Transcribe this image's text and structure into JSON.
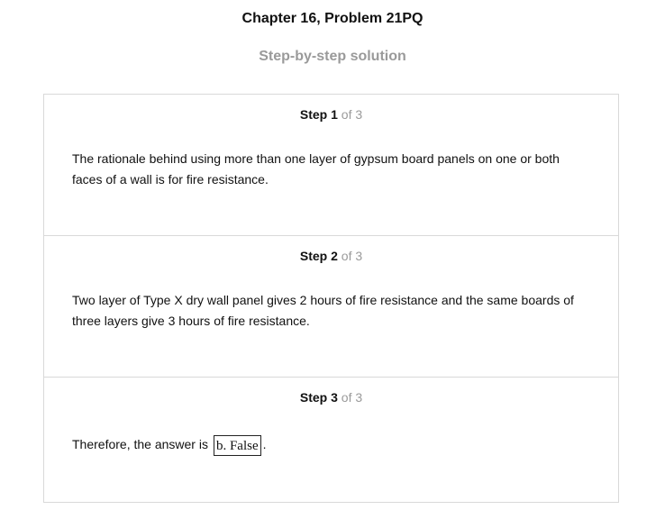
{
  "header": {
    "title": "Chapter 16, Problem 21PQ",
    "subtitle": "Step-by-step solution"
  },
  "steps": [
    {
      "label": "Step",
      "number": "1",
      "of_total": "of 3",
      "text": "The rationale behind using more than one layer of gypsum board panels on one or both faces of a wall is for fire resistance."
    },
    {
      "label": "Step",
      "number": "2",
      "of_total": "of 3",
      "text": "Two layer of Type X dry wall panel gives 2 hours of fire resistance and the same boards of three layers give 3 hours of fire resistance."
    },
    {
      "label": "Step",
      "number": "3",
      "of_total": "of 3",
      "text": "Therefore, the answer is",
      "answer": "b. False",
      "trailing": "."
    }
  ]
}
